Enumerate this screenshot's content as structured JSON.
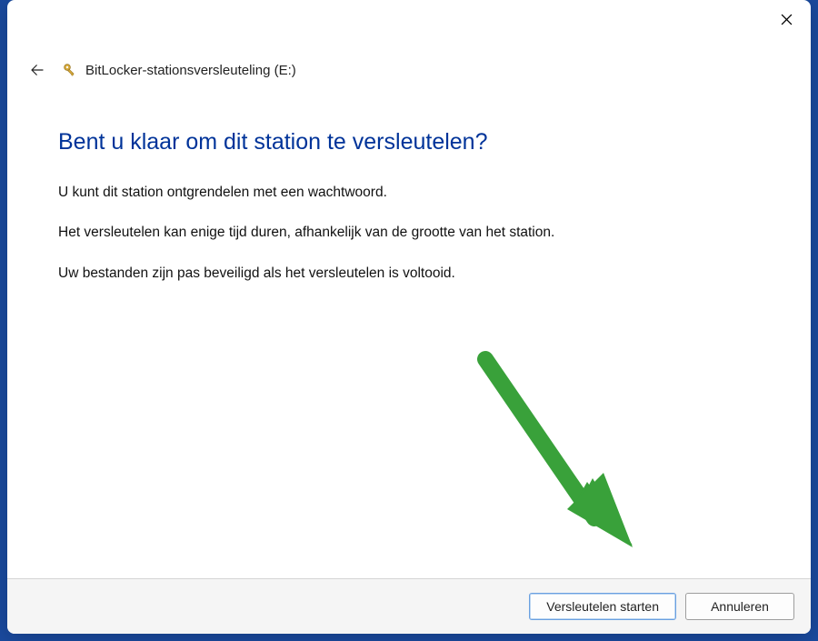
{
  "header": {
    "title": "BitLocker-stationsversleuteling (E:)"
  },
  "content": {
    "heading": "Bent u klaar om dit station te versleutelen?",
    "line1": "U kunt dit station ontgrendelen met een wachtwoord.",
    "line2": "Het versleutelen kan enige tijd duren, afhankelijk van de grootte van het station.",
    "line3": "Uw bestanden zijn pas beveiligd als het versleutelen is voltooid."
  },
  "footer": {
    "primary": "Versleutelen starten",
    "cancel": "Annuleren"
  },
  "colors": {
    "arrow": "#39a13a",
    "heading": "#003399"
  }
}
